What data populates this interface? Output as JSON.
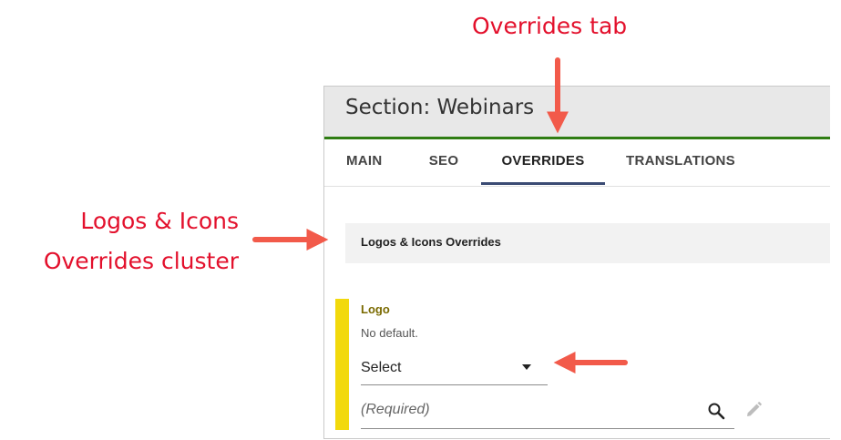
{
  "callouts": {
    "tab": "Overrides tab",
    "cluster_line1": "Logos & Icons",
    "cluster_line2": "Overrides cluster"
  },
  "panel": {
    "title": "Section: Webinars",
    "tabs": [
      {
        "label": "MAIN",
        "active": false
      },
      {
        "label": "SEO",
        "active": false
      },
      {
        "label": "OVERRIDES",
        "active": true
      },
      {
        "label": "TRANSLATIONS",
        "active": false
      }
    ],
    "cluster_title": "Logos & Icons Overrides",
    "field": {
      "label": "Logo",
      "help": "No default.",
      "select_value": "Select",
      "input_placeholder": "(Required)"
    }
  },
  "colors": {
    "callout": "#e3102c",
    "arrow": "#f25a4a",
    "header_rule": "#2f7d13",
    "active_tab_underline": "#3a4a73",
    "field_bar": "#f2d90c",
    "field_label": "#7a6a00"
  },
  "icons": {
    "search": "search-icon",
    "edit": "pencil-icon",
    "dropdown": "caret-down-icon"
  }
}
